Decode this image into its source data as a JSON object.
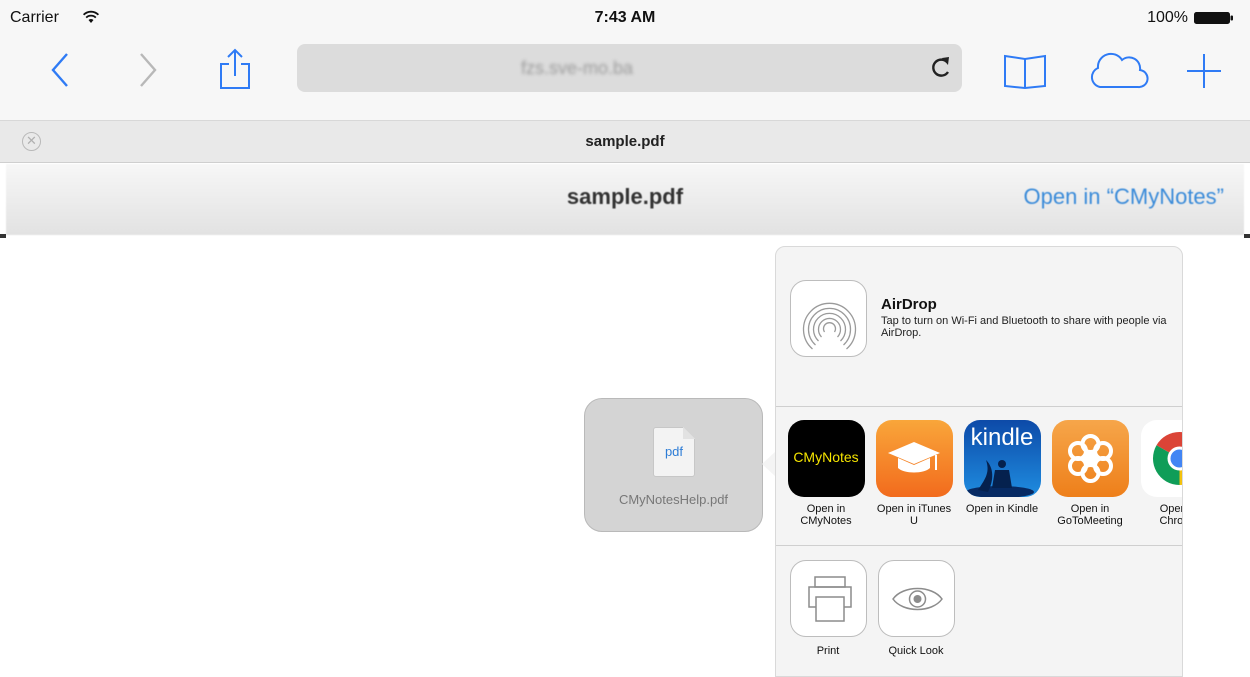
{
  "status_bar": {
    "carrier": "Carrier",
    "time": "7:43 AM",
    "battery": "100%"
  },
  "toolbar": {
    "url": "fzs.sve-mo.ba"
  },
  "tab": {
    "title": "sample.pdf"
  },
  "pdf_header": {
    "title": "sample.pdf",
    "open_in": "Open in “CMyNotes”"
  },
  "preview": {
    "file_ext": "pdf",
    "filename": "CMyNotesHelp.pdf"
  },
  "share_sheet": {
    "airdrop": {
      "title": "AirDrop",
      "description": "Tap to turn on Wi-Fi and Bluetooth to share with people via AirDrop."
    },
    "apps": [
      {
        "icon_text": "CMyNotes",
        "label": "Open in CMyNotes"
      },
      {
        "label": "Open in iTunes U"
      },
      {
        "icon_text": "kindle",
        "label": "Open in Kindle"
      },
      {
        "label": "Open in GoToMeeting"
      },
      {
        "label": "Open in Chrome"
      }
    ],
    "actions": [
      {
        "label": "Print"
      },
      {
        "label": "Quick Look"
      }
    ]
  },
  "colors": {
    "accent": "#2f7bf5",
    "link": "#3a8bd9",
    "cmynotes_text": "#f5e400",
    "itunesu": "#f47b20",
    "kindle": "#1a73c9",
    "gotomeeting": "#f08a24"
  }
}
